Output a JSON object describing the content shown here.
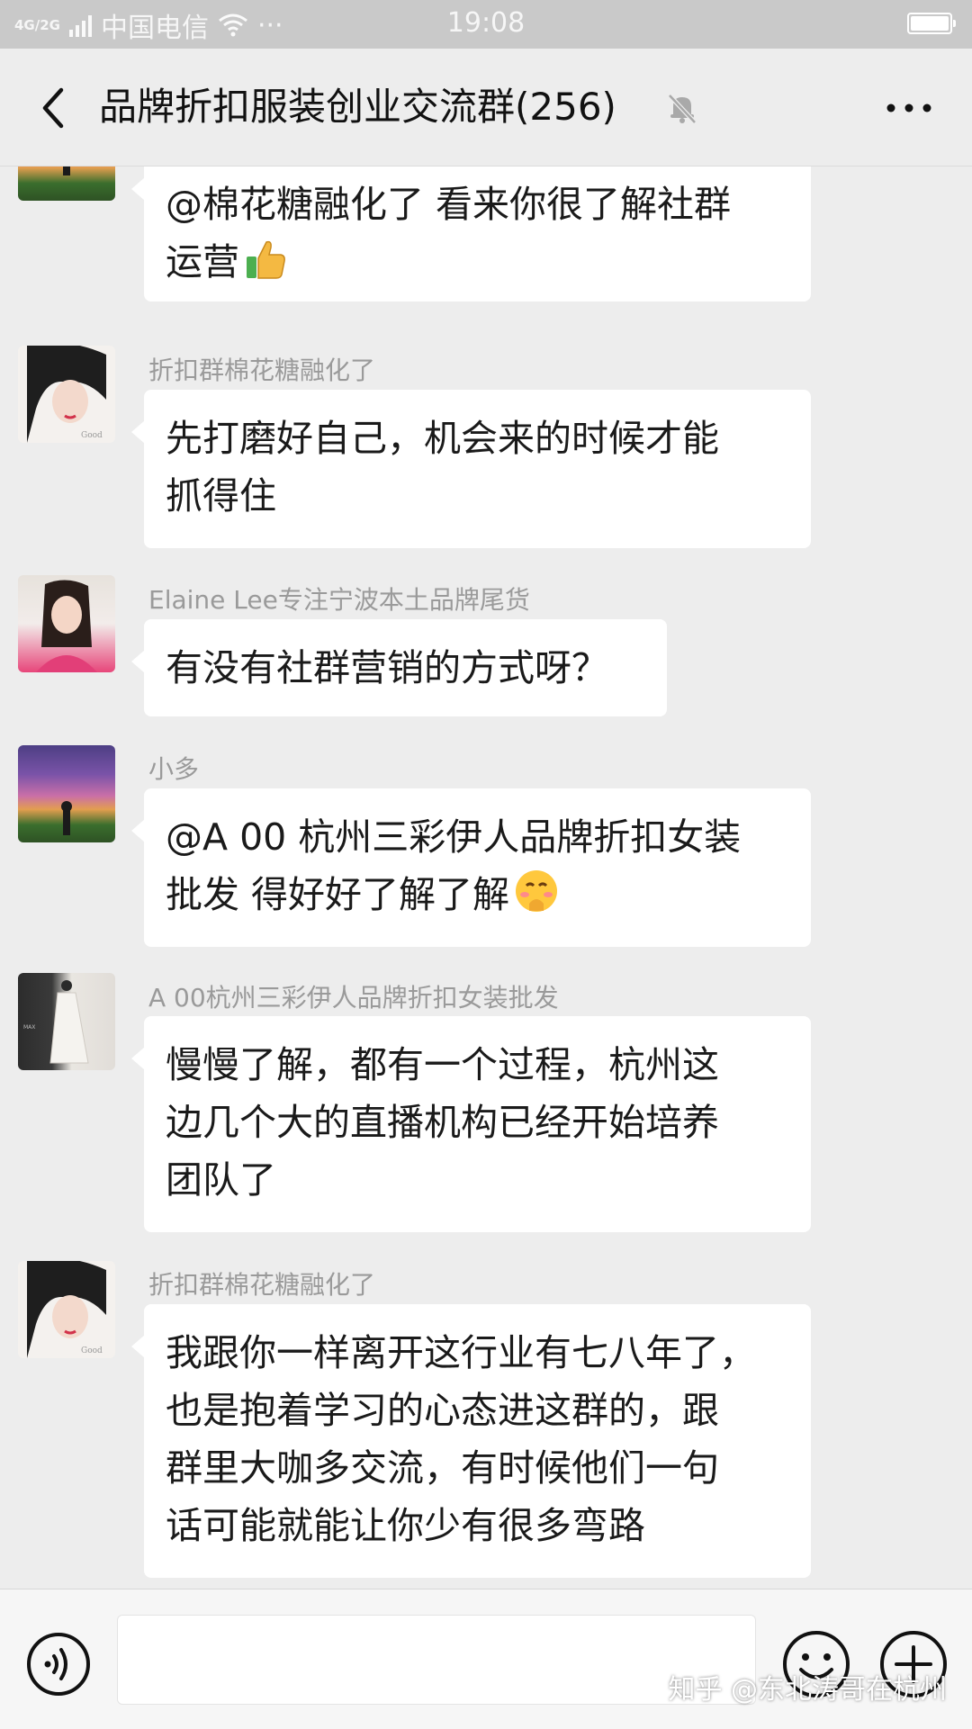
{
  "status_bar": {
    "network": "4G/2G",
    "carrier": "中国电信",
    "more": "···",
    "time": "19:08"
  },
  "header": {
    "title": "品牌折扣服装创业交流群(256)"
  },
  "messages": [
    {
      "sender": "",
      "lines": [
        "@棉花糖融化了  看来你很了解社群",
        "运营"
      ],
      "emoji": "thumbs-up"
    },
    {
      "sender": "折扣群棉花糖融化了",
      "lines": [
        "先打磨好自己，机会来的时候才能",
        "抓得住"
      ]
    },
    {
      "sender": "Elaine Lee专注宁波本土品牌尾货",
      "lines": [
        "有没有社群营销的方式呀？"
      ]
    },
    {
      "sender": "小多",
      "lines": [
        "@A 00 杭州三彩伊人品牌折扣女装",
        "批发  得好好了解了解"
      ],
      "emoji": "giggle-face"
    },
    {
      "sender": "A 00杭州三彩伊人品牌折扣女装批发",
      "lines": [
        "慢慢了解，都有一个过程，杭州这",
        "边几个大的直播机构已经开始培养",
        "团队了"
      ]
    },
    {
      "sender": "折扣群棉花糖融化了",
      "lines": [
        "我跟你一样离开这行业有七八年了，",
        "也是抱着学习的心态进这群的，跟",
        "群里大咖多交流，有时候他们一句",
        "话可能就能让你少有很多弯路"
      ]
    }
  ],
  "input_bar": {
    "watermark": "知乎 @东北涛哥在杭州"
  },
  "colors": {
    "background": "#ededed",
    "bubble": "#ffffff",
    "sender_name": "#9a9a9a"
  }
}
